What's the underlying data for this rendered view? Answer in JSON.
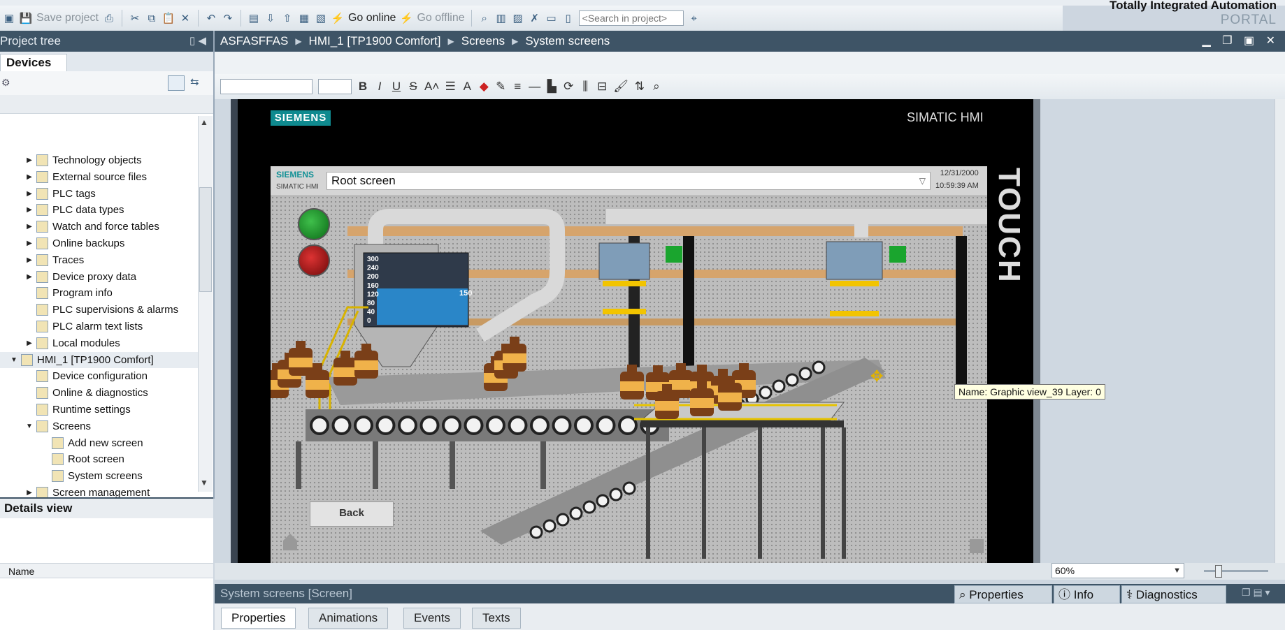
{
  "app": {
    "brand_line1": "Totally Integrated Automation",
    "brand_line2": "PORTAL"
  },
  "toolbar": {
    "save_project": "Save project",
    "go_online": "Go online",
    "go_offline": "Go offline",
    "search_placeholder": "<Search in project>"
  },
  "project_tree": {
    "title": "Project tree",
    "tab": "Devices",
    "items": [
      {
        "label": "Technology objects",
        "expanded": false
      },
      {
        "label": "External source files",
        "expanded": false
      },
      {
        "label": "PLC tags",
        "expanded": false
      },
      {
        "label": "PLC data types",
        "expanded": false
      },
      {
        "label": "Watch and force tables",
        "expanded": false
      },
      {
        "label": "Online backups",
        "expanded": false
      },
      {
        "label": "Traces",
        "expanded": false
      },
      {
        "label": "Device proxy data",
        "expanded": false
      },
      {
        "label": "Program info"
      },
      {
        "label": "PLC supervisions & alarms"
      },
      {
        "label": "PLC alarm text lists"
      },
      {
        "label": "Local modules",
        "expanded": false
      },
      {
        "label": "HMI_1 [TP1900 Comfort]",
        "expanded": true
      },
      {
        "label": "Device configuration"
      },
      {
        "label": "Online & diagnostics"
      },
      {
        "label": "Runtime settings"
      },
      {
        "label": "Screens",
        "expanded": true
      },
      {
        "label": "Add new screen"
      },
      {
        "label": "Root screen"
      },
      {
        "label": "System screens"
      },
      {
        "label": "Screen management",
        "expanded": false
      },
      {
        "label": "HMI tags",
        "expanded": false
      },
      {
        "label": "Connections"
      }
    ]
  },
  "details_view": {
    "title": "Details view",
    "column_name": "Name"
  },
  "editor": {
    "breadcrumb": [
      "ASFASFFAS",
      "HMI_1 [TP1900 Comfort]",
      "Screens",
      "System screens"
    ]
  },
  "hmi": {
    "logo": "SIEMENS",
    "simatic_label": "SIMATIC HMI",
    "touch_label": "TOUCH",
    "small_siemens": "SIEMENS",
    "small_simatic": "SIMATIC HMI",
    "screen_selector": "Root screen",
    "date": "12/31/2000",
    "time": "10:59:39 AM",
    "back_button": "Back",
    "tank_scale": [
      "300",
      "240",
      "200",
      "160",
      "120",
      "80",
      "40",
      "0"
    ],
    "tank_value": "150"
  },
  "tooltip": "Name: Graphic view_39   Layer: 0",
  "zoom": "60%",
  "inspector": {
    "title": "System screens [Screen]",
    "tabs": [
      "Properties",
      "Info",
      "Diagnostics"
    ],
    "sub_tabs": [
      "Properties",
      "Animations",
      "Events",
      "Texts"
    ],
    "active_sub_tab": "Properties"
  },
  "colors": {
    "panel_header": "#3e5466",
    "siemens_teal": "#0f8a8f",
    "tooltip_bg": "#ffffe1"
  }
}
